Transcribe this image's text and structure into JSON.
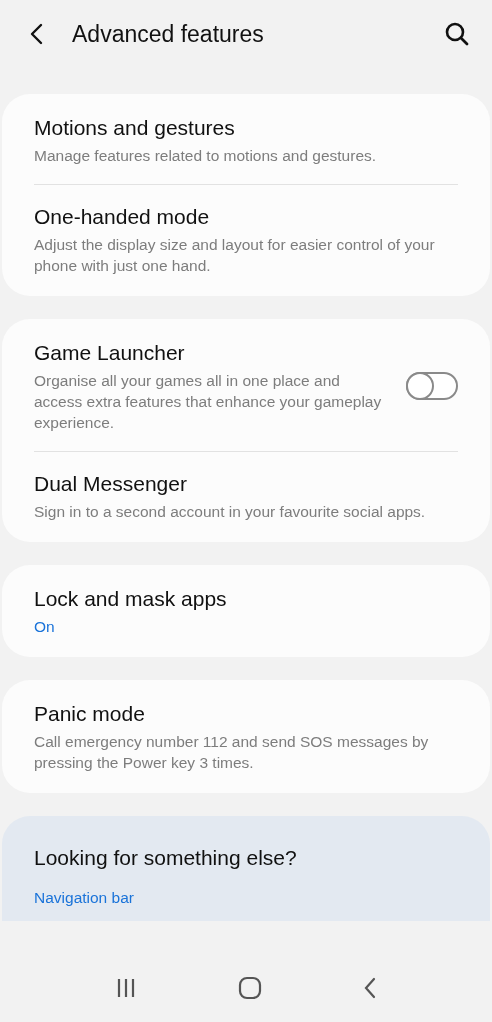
{
  "header": {
    "title": "Advanced features"
  },
  "groups": [
    {
      "items": [
        {
          "kind": "plain",
          "title": "Motions and gestures",
          "description": "Manage features related to motions and gestures."
        },
        {
          "kind": "plain",
          "title": "One-handed mode",
          "description": "Adjust the display size and layout for easier control of your phone with just one hand."
        }
      ]
    },
    {
      "items": [
        {
          "kind": "toggle",
          "title": "Game Launcher",
          "description": "Organise all your games all in one place and access extra features that enhance your gameplay experience.",
          "on": false
        },
        {
          "kind": "plain",
          "title": "Dual Messenger",
          "description": "Sign in to a second account in your favourite social apps."
        }
      ]
    },
    {
      "items": [
        {
          "kind": "status",
          "title": "Lock and mask apps",
          "status": "On"
        }
      ]
    },
    {
      "items": [
        {
          "kind": "plain",
          "title": "Panic mode",
          "description": "Call emergency number 112 and send SOS messages by pressing the Power key 3 times."
        }
      ]
    }
  ],
  "suggestions": {
    "title": "Looking for something else?",
    "links": [
      "Navigation bar"
    ]
  }
}
